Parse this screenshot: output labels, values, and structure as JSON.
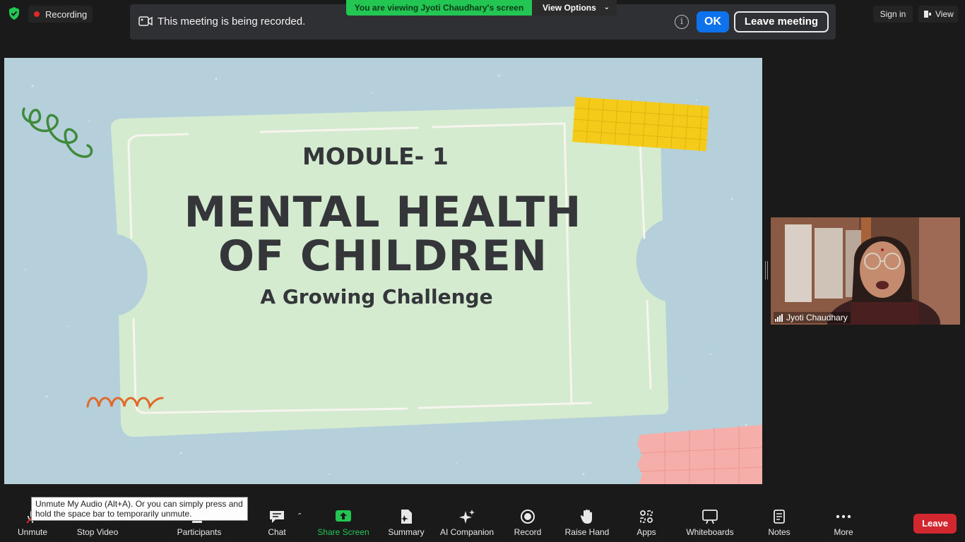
{
  "recording": {
    "label": "Recording"
  },
  "banner": {
    "message": "This meeting is being recorded.",
    "ok_label": "OK",
    "leave_meeting_label": "Leave meeting"
  },
  "viewing": {
    "message": "You are viewing Jyoti Chaudhary's screen",
    "view_options_label": "View Options"
  },
  "top_right": {
    "sign_in_label": "Sign in",
    "view_label": "View"
  },
  "slide": {
    "module": "MODULE- 1",
    "title_line1": "MENTAL HEALTH",
    "title_line2": "OF CHILDREN",
    "subtitle": "A Growing Challenge"
  },
  "participant": {
    "name": "Jyoti Chaudhary"
  },
  "tooltip": {
    "text": "Unmute My Audio (Alt+A). Or you can simply press and hold the space bar to temporarily unmute."
  },
  "toolbar": {
    "unmute": "Unmute",
    "stop_video": "Stop Video",
    "participants": "Participants",
    "chat": "Chat",
    "share_screen": "Share Screen",
    "summary": "Summary",
    "ai_companion": "AI Companion",
    "record": "Record",
    "raise_hand": "Raise Hand",
    "apps": "Apps",
    "whiteboards": "Whiteboards",
    "notes": "Notes",
    "more": "More",
    "leave": "Leave"
  },
  "colors": {
    "accent_blue": "#0e72ed",
    "share_green": "#23c553",
    "leave_red": "#d2272e",
    "slide_bg": "#b5cfdb",
    "ticket_green": "#d4ebd0"
  }
}
